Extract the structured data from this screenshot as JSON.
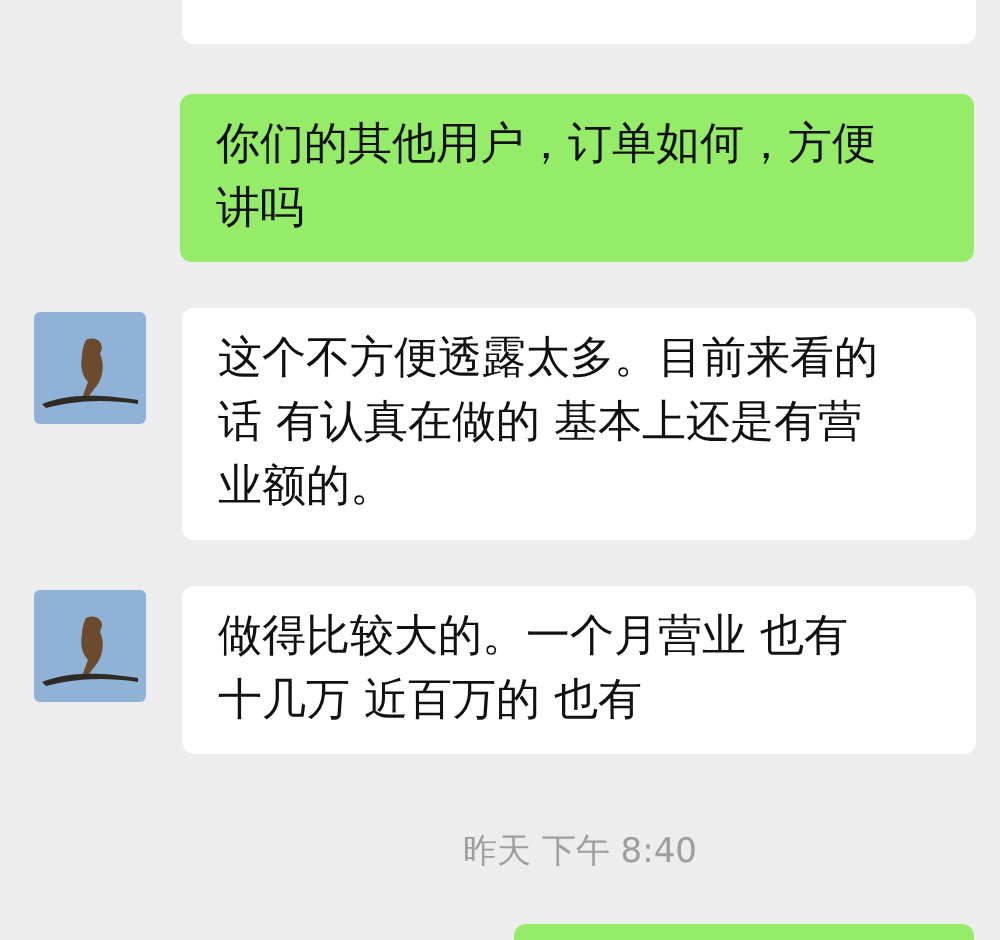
{
  "messages": [
    {
      "kind": "cut_received"
    },
    {
      "kind": "sent",
      "lines": [
        "你们的其他用户，订单如何，方便",
        "讲吗"
      ]
    },
    {
      "kind": "received",
      "lines": [
        "这个不方便透露太多。目前来看的",
        "话 有认真在做的 基本上还是有营",
        "业额的。"
      ]
    },
    {
      "kind": "received",
      "lines": [
        "做得比较大的。一个月营业 也有",
        "十几万 近百万的 也有"
      ]
    },
    {
      "kind": "time",
      "text": "昨天 下午 8:40"
    },
    {
      "kind": "cut_sent"
    }
  ]
}
